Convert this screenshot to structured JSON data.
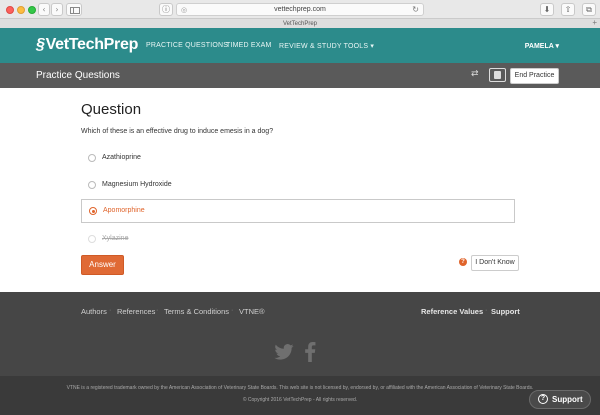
{
  "browser": {
    "url": "vettechprep.com",
    "tab_title": "VetTechPrep",
    "back_glyph": "‹",
    "forward_glyph": "›",
    "info_glyph": "ⓘ",
    "reload_glyph": "↻",
    "download_glyph": "⬇",
    "share_glyph": "⇧",
    "tabs_glyph": "⧉",
    "new_tab_glyph": "+"
  },
  "nav": {
    "logo": "VetTechPrep",
    "links": [
      "PRACTICE QUESTIONS",
      "TIMED EXAM",
      "REVIEW & STUDY TOOLS ▾"
    ],
    "user": "PAMELA ▾"
  },
  "subheader": {
    "title": "Practice Questions",
    "shuffle_glyph": "⇄",
    "end_label": "End Practice"
  },
  "question": {
    "heading": "Question",
    "text": "Which of these is an effective drug to induce emesis in a dog?",
    "options": [
      {
        "label": "Azathioprine",
        "state": "unselected"
      },
      {
        "label": "Magnesium Hydroxide",
        "state": "unselected"
      },
      {
        "label": "Apomorphine",
        "state": "selected"
      },
      {
        "label": "Xylazine",
        "state": "eliminated"
      }
    ],
    "answer_label": "Answer",
    "help_glyph": "?",
    "idk_label": "I Don't Know"
  },
  "footer": {
    "links": [
      "Authors",
      "References",
      "Terms & Conditions",
      "VTNE®"
    ],
    "separator": "·",
    "right_links": [
      "Reference Values",
      "Support"
    ],
    "legal_1": "VTNE is a registered trademark owned by the American Association of Veterinary State Boards. This web site is not licensed by, endorsed by, or affiliated with the American Association of Veterinary State Boards.",
    "legal_2": "© Copyright 2016 VetTechPrep - All rights reserved."
  },
  "support": {
    "icon": "?",
    "label": "Support"
  },
  "colors": {
    "nav_teal": "#2c8b8b",
    "subheader_gray": "#5a5a5a",
    "accent_orange": "#e06a35",
    "footer_dark": "#464646"
  }
}
